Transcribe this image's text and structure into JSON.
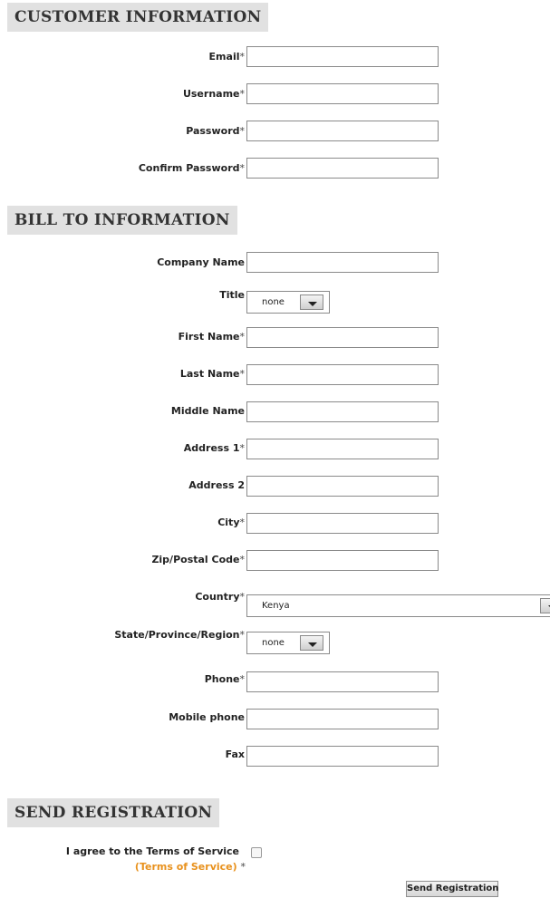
{
  "sections": {
    "customer": "CUSTOMER INFORMATION",
    "bill_to": "BILL TO INFORMATION",
    "send": "SEND REGISTRATION"
  },
  "required_marker": "*",
  "customer_fields": {
    "email": "Email",
    "username": "Username",
    "password": "Password",
    "confirm_password": "Confirm Password"
  },
  "bill_fields": {
    "company_name": "Company Name",
    "title": "Title",
    "first_name": "First Name",
    "last_name": "Last Name",
    "middle_name": "Middle Name",
    "address1": "Address 1",
    "address2": "Address 2",
    "city": "City",
    "zip": "Zip/Postal Code",
    "country": "Country",
    "state": "State/Province/Region",
    "phone": "Phone",
    "mobile": "Mobile phone",
    "fax": "Fax"
  },
  "selects": {
    "title_value": "none",
    "country_value": "Kenya",
    "state_value": "none"
  },
  "terms": {
    "agree_label": "I agree to the Terms of Service",
    "link_text": "(Terms of Service)"
  },
  "submit_label": "Send Registration"
}
